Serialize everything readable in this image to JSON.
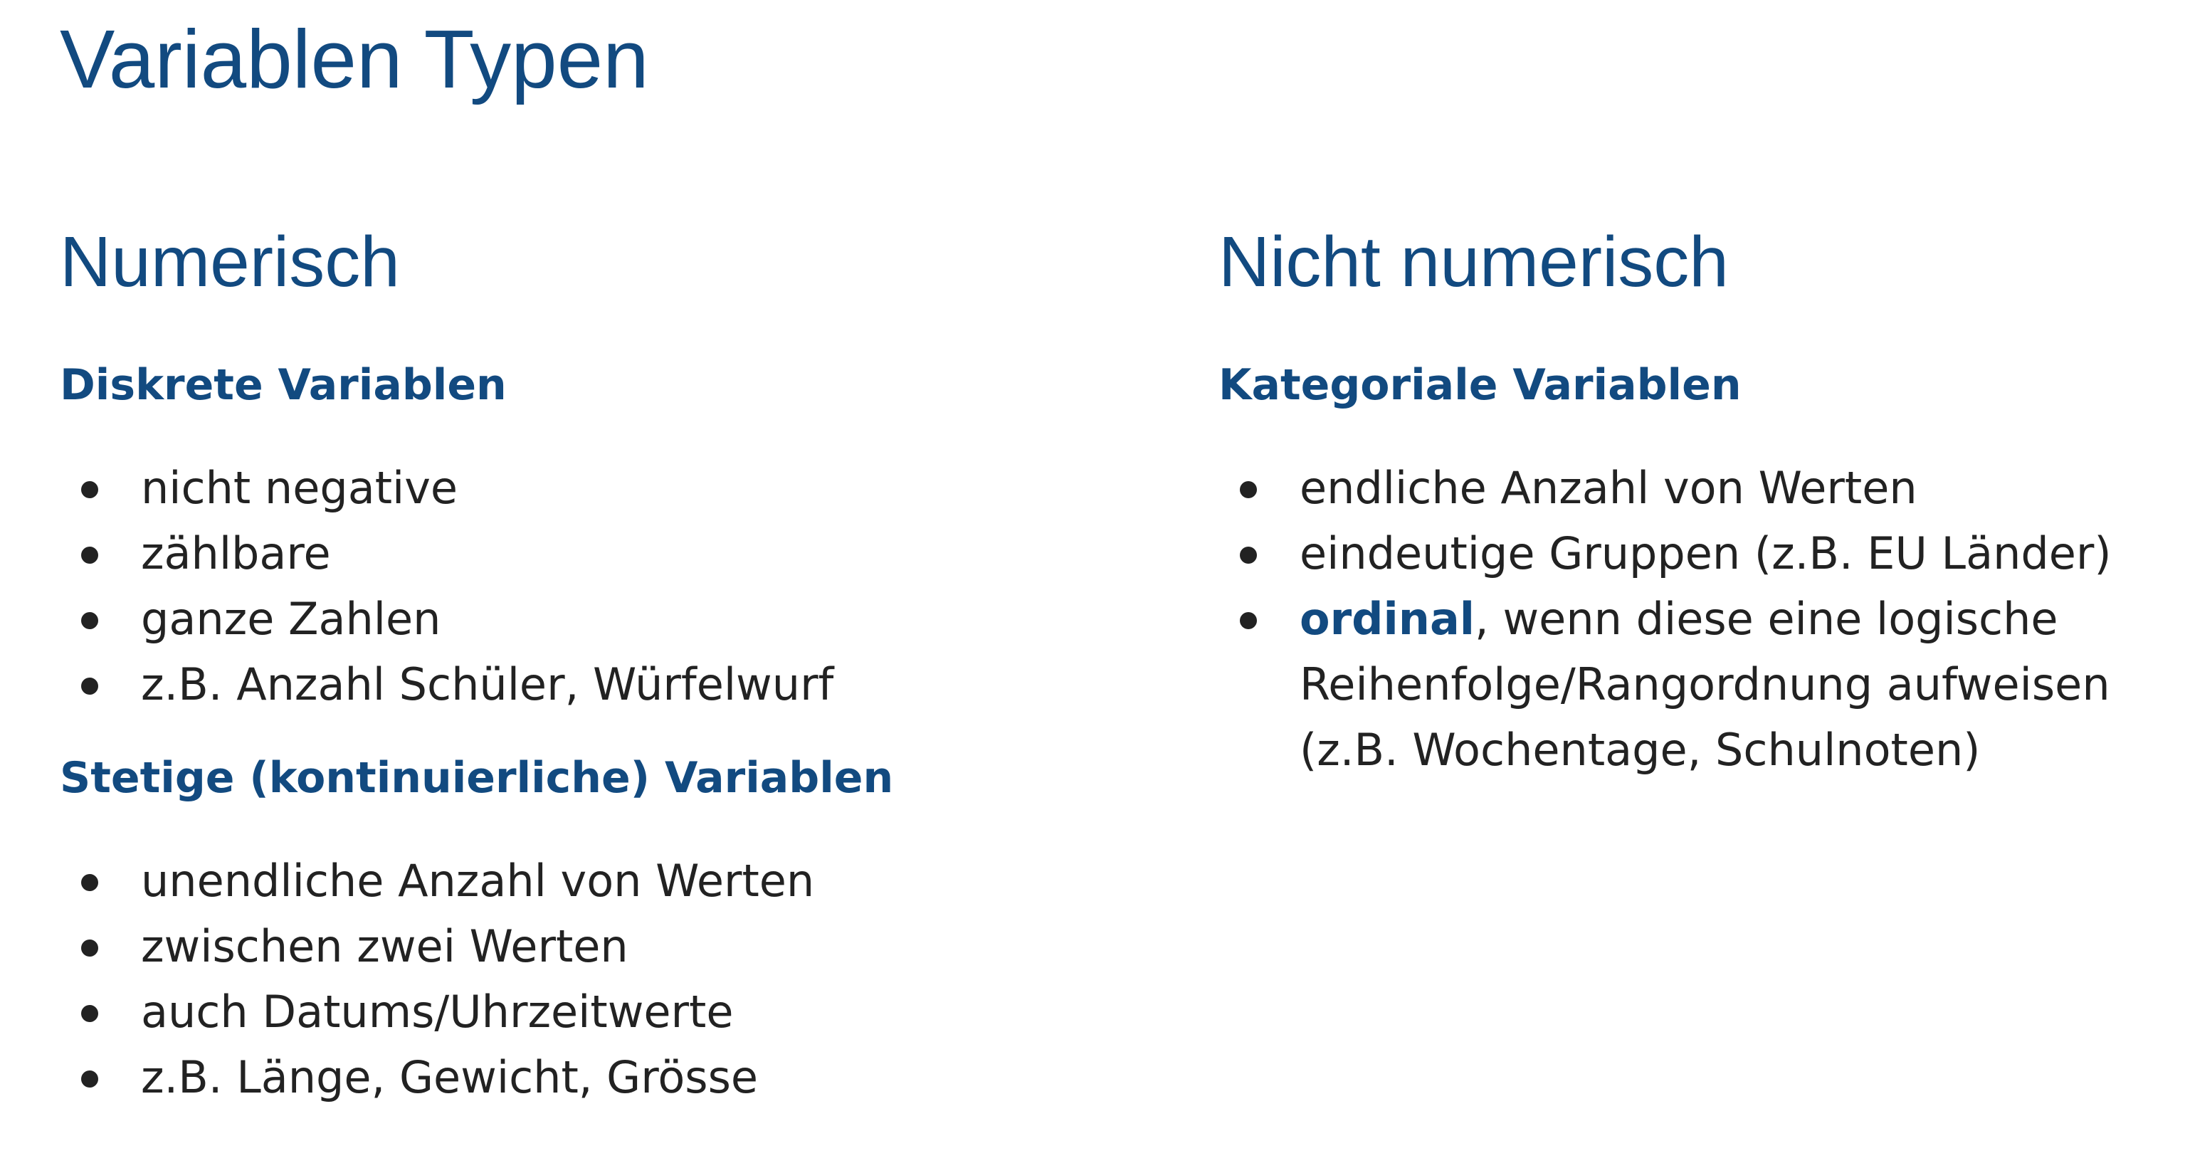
{
  "title": "Variablen Typen",
  "left": {
    "heading": "Numerisch",
    "sections": [
      {
        "subheading": "Diskrete Variablen",
        "items": [
          "nicht negative",
          "zählbare",
          "ganze Zahlen",
          "z.B. Anzahl Schüler, Würfelwurf"
        ]
      },
      {
        "subheading": "Stetige (kontinuierliche) Variablen",
        "items": [
          "unendliche Anzahl von Werten",
          "zwischen zwei Werten",
          "auch Datums/Uhrzeitwerte",
          "z.B. Länge, Gewicht, Grösse"
        ]
      }
    ]
  },
  "right": {
    "heading": "Nicht numerisch",
    "sections": [
      {
        "subheading": "Kategoriale Variablen",
        "items": [
          "endliche Anzahl von Werten",
          "eindeutige Gruppen (z.B. EU Länder)"
        ],
        "ordinal_item": {
          "emphasis": "ordinal",
          "rest": ", wenn diese eine logische Reihenfolge/Rangordnung aufweisen (z.B. Wochentage, Schulnoten)"
        }
      }
    ]
  },
  "colors": {
    "accent": "#124a80",
    "text": "#222222",
    "background": "#ffffff"
  }
}
